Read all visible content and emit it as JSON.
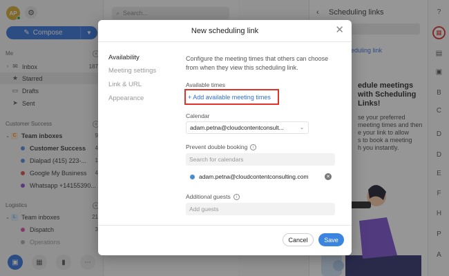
{
  "sidebar": {
    "avatar_initials": "AP",
    "compose_label": "Compose",
    "me_label": "Me",
    "me_items": [
      {
        "label": "Inbox",
        "count": "187",
        "icon": "inbox-icon"
      },
      {
        "label": "Starred",
        "count": "",
        "icon": "star-icon"
      },
      {
        "label": "Drafts",
        "count": "",
        "icon": "draft-icon"
      },
      {
        "label": "Sent",
        "count": "",
        "icon": "sent-icon"
      }
    ],
    "cs_label": "Customer Success",
    "cs_team": {
      "badge": "C",
      "label": "Team inboxes",
      "count": "9"
    },
    "cs_items": [
      {
        "label": "Customer Success",
        "count": "4",
        "color": "#4a8ad4",
        "bold": true
      },
      {
        "label": "Dialpad (415) 223-...",
        "count": "1",
        "color": "#4a8ad4",
        "bold": false
      },
      {
        "label": "Google My Business",
        "count": "4",
        "color": "#d84a4a",
        "bold": false
      },
      {
        "label": "Whatsapp +14155390...",
        "count": "",
        "color": "#8a4ad4",
        "bold": false
      }
    ],
    "log_label": "Logistics",
    "log_team": {
      "badge": "L",
      "label": "Team inboxes",
      "count": "21"
    },
    "log_items": [
      {
        "label": "Dispatch",
        "count": "3",
        "color": "#d84aa4"
      },
      {
        "label": "Operations",
        "count": "",
        "color": "#aaaaaa"
      }
    ]
  },
  "middle": {
    "search_placeholder": "Search..."
  },
  "rightpane": {
    "title": "Scheduling links",
    "link": "eduling link",
    "heading_line1": "edule meetings",
    "heading_line2": "with Scheduling",
    "heading_line3": "Links!",
    "text_lines": [
      "se your preferred",
      "meeting times and then",
      "e your link to allow",
      "s to book a meeting",
      "h you instantly."
    ]
  },
  "rail": {
    "letters": [
      "B",
      "C",
      "D",
      "D",
      "E",
      "F",
      "H",
      "P",
      "A"
    ]
  },
  "modal": {
    "title": "New scheduling link",
    "nav": [
      "Availability",
      "Meeting settings",
      "Link & URL",
      "Appearance"
    ],
    "description": "Configure the meeting times that others can choose from when they view this scheduling link.",
    "available_times_label": "Available times",
    "add_times_link": "+ Add available meeting times",
    "calendar_label": "Calendar",
    "calendar_value": "adam.petna@cloudcontentconsult...",
    "prevent_label": "Prevent double booking",
    "search_calendars_placeholder": "Search for calendars",
    "selected_calendar": "adam.petna@cloudcontentconsulting.com",
    "guests_label": "Additional guests",
    "add_guests_placeholder": "Add guests",
    "cancel_label": "Cancel",
    "save_label": "Save"
  },
  "colors": {
    "accent": "#2f6fd6",
    "highlight_border": "#e03327",
    "save_button": "#3b84e0"
  }
}
